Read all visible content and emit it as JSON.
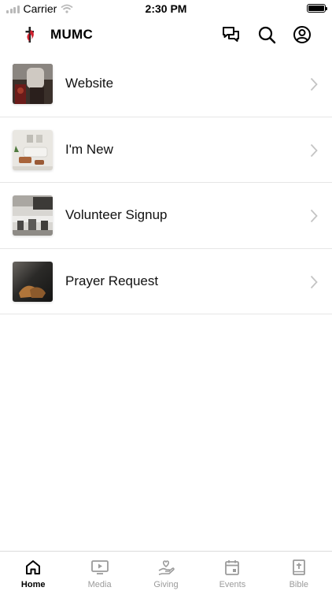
{
  "status_bar": {
    "carrier": "Carrier",
    "time": "2:30 PM",
    "icons": [
      "signal-icon",
      "wifi-icon",
      "battery-icon"
    ]
  },
  "header": {
    "title": "MUMC",
    "logo_icon": "cross-flame-logo",
    "actions": [
      "chat-icon",
      "search-icon",
      "profile-icon"
    ]
  },
  "list": {
    "items": [
      {
        "label": "Website",
        "thumb": "website-photo"
      },
      {
        "label": "I'm New",
        "thumb": "living-room-photo"
      },
      {
        "label": "Volunteer Signup",
        "thumb": "coffee-bar-photo"
      },
      {
        "label": "Prayer Request",
        "thumb": "prayer-hands-photo"
      }
    ]
  },
  "tabbar": {
    "active": "Home",
    "tabs": [
      {
        "label": "Home",
        "icon": "home-icon"
      },
      {
        "label": "Media",
        "icon": "media-icon"
      },
      {
        "label": "Giving",
        "icon": "giving-icon"
      },
      {
        "label": "Events",
        "icon": "events-icon"
      },
      {
        "label": "Bible",
        "icon": "bible-icon"
      }
    ]
  },
  "colors": {
    "logo_red": "#d0202e",
    "text": "#000000",
    "tab_inactive": "#9b9b9b",
    "divider": "#e6e6e6"
  }
}
